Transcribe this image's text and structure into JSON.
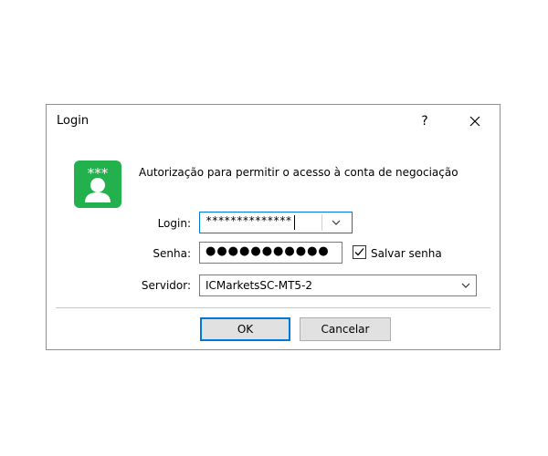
{
  "dialog": {
    "title": "Login",
    "help_label": "?",
    "description": "Autorização para permitir o acesso à conta de negociação",
    "icon_text": "***"
  },
  "form": {
    "login_label": "Login:",
    "login_value": "**************",
    "senha_label": "Senha:",
    "senha_value": "●●●●●●●●●●●",
    "save_password_label": "Salvar senha",
    "save_password_checked": true,
    "servidor_label": "Servidor:",
    "servidor_value": "ICMarketsSC-MT5-2"
  },
  "buttons": {
    "ok_label": "OK",
    "cancel_label": "Cancelar"
  },
  "colors": {
    "accent": "#0078d7",
    "icon_green": "#22b14c",
    "button_bg": "#e1e1e1"
  }
}
